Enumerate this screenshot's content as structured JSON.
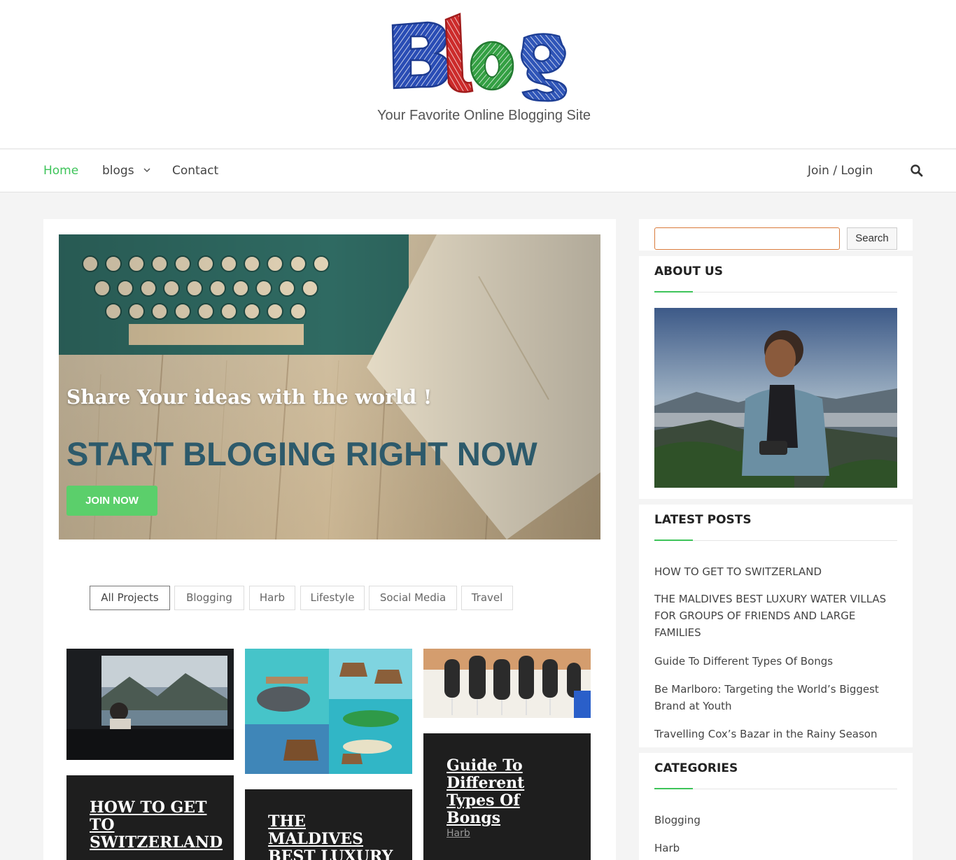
{
  "header": {
    "logo_text": "Blog",
    "tagline": "Your Favorite Online Blogging Site"
  },
  "nav": {
    "home": "Home",
    "blogs": "blogs",
    "contact": "Contact",
    "login": "Join / Login"
  },
  "hero": {
    "title": "Share Your ideas with the world !",
    "heading": "START BLOGING RIGHT NOW",
    "button": "JOIN NOW"
  },
  "filters": [
    "All Projects",
    "Blogging",
    "Harb",
    "Lifestyle",
    "Social Media",
    "Travel"
  ],
  "cards": [
    {
      "title": "HOW TO GET TO SWITZERLAND"
    },
    {
      "title": "THE MALDIVES BEST LUXURY WATER VILLAS"
    },
    {
      "title": "Guide To Different Types Of Bongs",
      "category": "Harb"
    }
  ],
  "sidebar": {
    "search_button": "Search",
    "about_title": "ABOUT US",
    "latest_title": "LATEST POSTS",
    "latest_posts": [
      "HOW TO GET TO SWITZERLAND",
      "THE MALDIVES BEST LUXURY WATER VILLAS FOR GROUPS OF FRIENDS AND LARGE FAMILIES",
      "Guide To Different Types Of Bongs",
      "Be Marlboro: Targeting the World’s Biggest Brand at Youth",
      "Travelling Cox’s Bazar in the Rainy Season"
    ],
    "categories_title": "CATEGORIES",
    "categories": [
      "Blogging",
      "Harb"
    ]
  },
  "colors": {
    "accent_green": "#3ec45a",
    "hero_heading": "#2d5a6b",
    "dark_card": "#1e1e1e"
  }
}
